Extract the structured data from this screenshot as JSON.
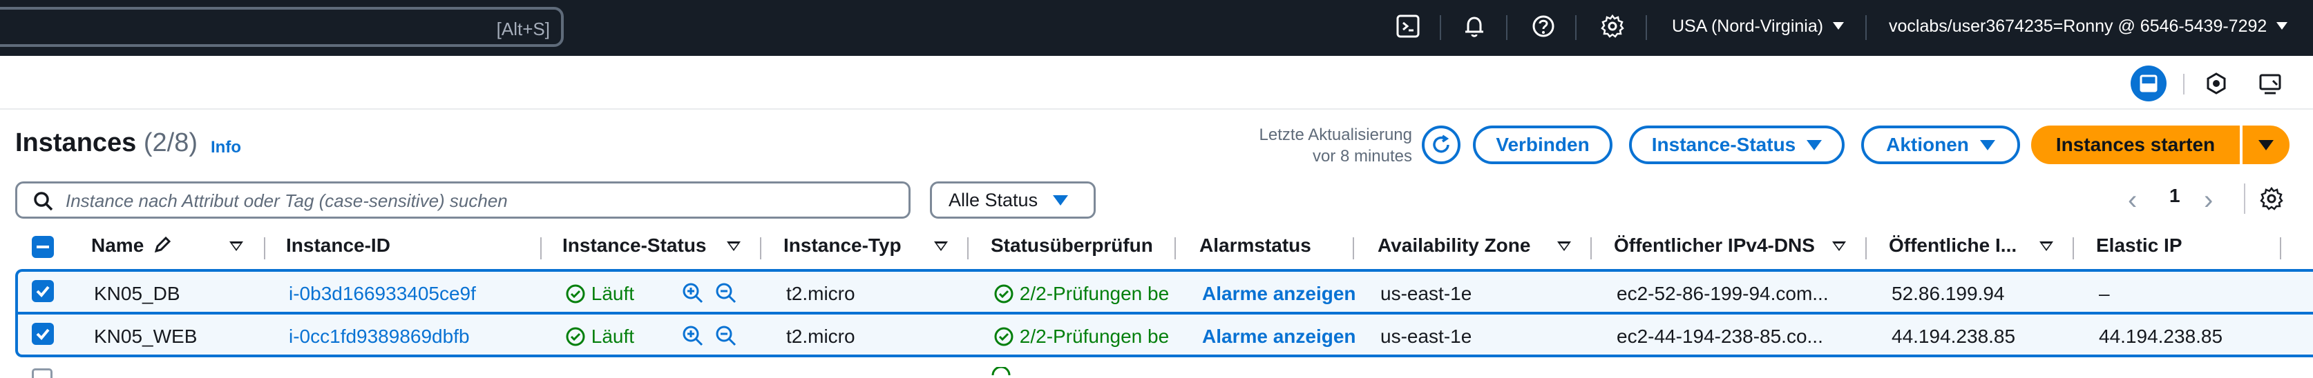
{
  "topnav": {
    "search_shortcut": "[Alt+S]",
    "region": "USA (Nord-Virginia)",
    "account": "voclabs/user3674235=Ronny @ 6546-5439-7292",
    "icons": [
      "cloudshell-icon",
      "bell-icon",
      "help-icon",
      "settings-icon"
    ]
  },
  "header": {
    "title": "Instances",
    "count": "(2/8)",
    "info": "Info",
    "last_update_line1": "Letzte Aktualisierung",
    "last_update_line2": "vor 8 minutes",
    "buttons": {
      "connect": "Verbinden",
      "instance_state": "Instance-Status",
      "actions": "Aktionen",
      "launch": "Instances starten"
    }
  },
  "filter": {
    "placeholder": "Instance nach Attribut oder Tag (case-sensitive) suchen",
    "status_select": "Alle Status"
  },
  "pagination": {
    "page": "1"
  },
  "table": {
    "columns": [
      "Name",
      "Instance-ID",
      "Instance-Status",
      "Instance-Typ",
      "Statusüberprüfun",
      "Alarmstatus",
      "Availability Zone",
      "Öffentlicher IPv4-DNS",
      "Öffentliche I...",
      "Elastic IP"
    ],
    "rows": [
      {
        "name": "KN05_DB",
        "instance_id": "i-0b3d166933405ce9f",
        "state": "Läuft",
        "type": "t2.micro",
        "checks": "2/2-Prüfungen be",
        "alarm": "Alarme anzeigen",
        "az": "us-east-1e",
        "dns": "ec2-52-86-199-94.com...",
        "public_ip": "52.86.199.94",
        "elastic_ip": "–"
      },
      {
        "name": "KN05_WEB",
        "instance_id": "i-0cc1fd9389869dbfb",
        "state": "Läuft",
        "type": "t2.micro",
        "checks": "2/2-Prüfungen be",
        "alarm": "Alarme anzeigen",
        "az": "us-east-1e",
        "dns": "ec2-44-194-238-85.co...",
        "public_ip": "44.194.238.85",
        "elastic_ip": "44.194.238.85"
      }
    ]
  },
  "colors": {
    "accent": "#0972d3",
    "launch": "#ff9900",
    "nav_bg": "#161d26",
    "success": "#037f0c"
  }
}
